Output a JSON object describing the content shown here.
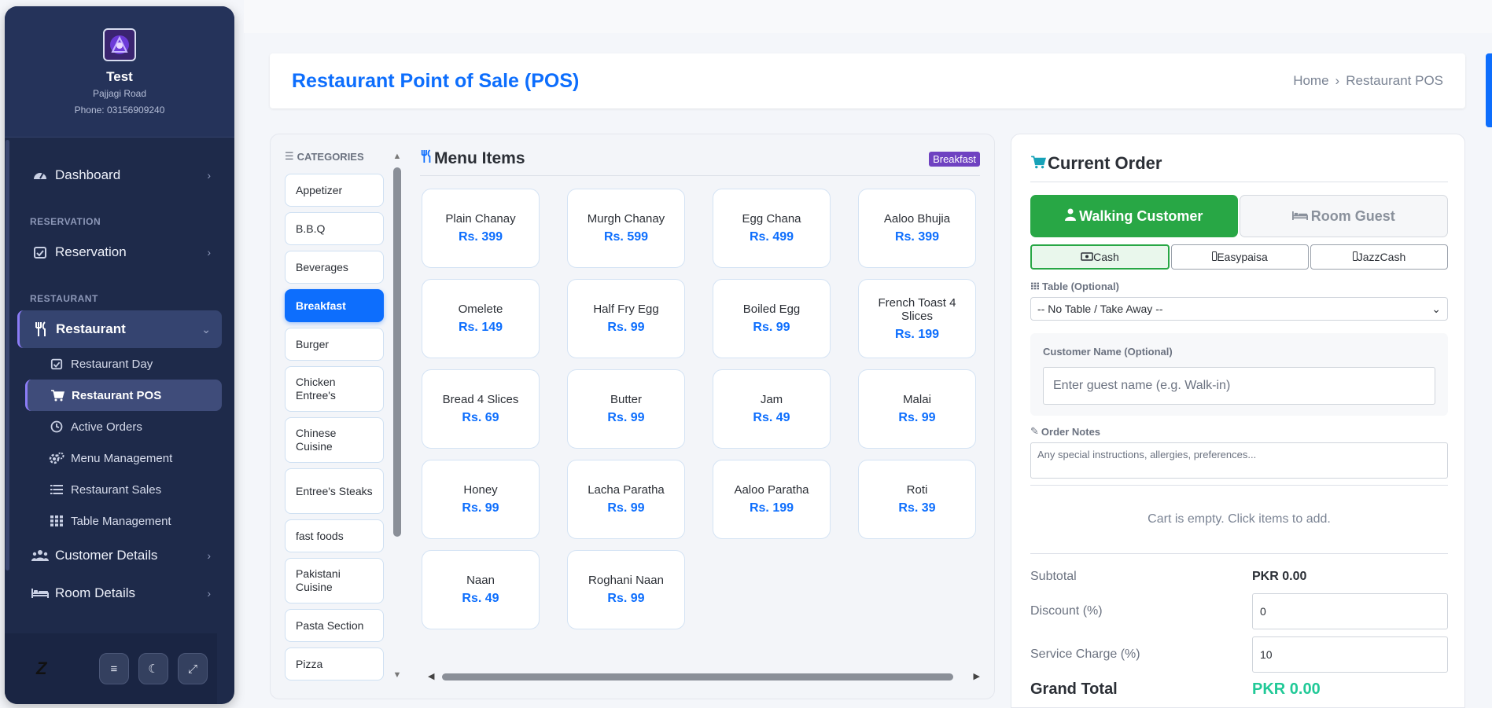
{
  "sidebar": {
    "business_name": "Test",
    "address": "Pajjagi Road",
    "phone": "Phone: 03156909240",
    "nav": {
      "dashboard": "Dashboard",
      "section_reservation": "RESERVATION",
      "reservation": "Reservation",
      "section_restaurant": "RESTAURANT",
      "restaurant": "Restaurant",
      "sub_items": [
        "Restaurant Day",
        "Restaurant POS",
        "Active Orders",
        "Menu Management",
        "Restaurant Sales",
        "Table Management"
      ],
      "customer_details": "Customer Details",
      "room_details": "Room Details"
    },
    "footer_logo": "Z"
  },
  "header": {
    "title": "Restaurant Point of Sale (POS)",
    "breadcrumb_home": "Home",
    "breadcrumb_current": "Restaurant POS"
  },
  "categories": {
    "heading": "CATEGORIES",
    "items": [
      "Appetizer",
      "B.B.Q",
      "Beverages",
      "Breakfast",
      "Burger",
      "Chicken Entree's",
      "Chinese Cuisine",
      "Entree's Steaks",
      "fast foods",
      "Pakistani Cuisine",
      "Pasta Section",
      "Pizza"
    ],
    "selected": "Breakfast"
  },
  "menu": {
    "title": "Menu Items",
    "badge": "Breakfast",
    "items": [
      {
        "name": "Plain Chanay",
        "price": "Rs. 399"
      },
      {
        "name": "Murgh Chanay",
        "price": "Rs. 599"
      },
      {
        "name": "Egg Chana",
        "price": "Rs. 499"
      },
      {
        "name": "Aaloo Bhujia",
        "price": "Rs. 399"
      },
      {
        "name": "Omelete",
        "price": "Rs. 149"
      },
      {
        "name": "Half Fry Egg",
        "price": "Rs. 99"
      },
      {
        "name": "Boiled Egg",
        "price": "Rs. 99"
      },
      {
        "name": "French Toast 4 Slices",
        "price": "Rs. 199"
      },
      {
        "name": "Bread 4 Slices",
        "price": "Rs. 69"
      },
      {
        "name": "Butter",
        "price": "Rs. 99"
      },
      {
        "name": "Jam",
        "price": "Rs. 49"
      },
      {
        "name": "Malai",
        "price": "Rs. 99"
      },
      {
        "name": "Honey",
        "price": "Rs. 99"
      },
      {
        "name": "Lacha Paratha",
        "price": "Rs. 99"
      },
      {
        "name": "Aaloo Paratha",
        "price": "Rs. 199"
      },
      {
        "name": "Roti",
        "price": "Rs. 39"
      },
      {
        "name": "Naan",
        "price": "Rs. 49"
      },
      {
        "name": "Roghani Naan",
        "price": "Rs. 99"
      }
    ]
  },
  "order": {
    "title": "Current Order",
    "walking_customer": "Walking Customer",
    "room_guest": "Room Guest",
    "payment": {
      "cash": "Cash",
      "easypaisa": "Easypaisa",
      "jazzcash": "JazzCash"
    },
    "table_label": "Table (Optional)",
    "table_value": "-- No Table / Take Away --",
    "customer_label": "Customer Name (Optional)",
    "customer_placeholder": "Enter guest name (e.g. Walk-in)",
    "notes_label": "Order Notes",
    "notes_placeholder": "Any special instructions, allergies, preferences...",
    "empty": "Cart is empty. Click items to add.",
    "subtotal_label": "Subtotal",
    "subtotal_value": "PKR 0.00",
    "discount_label": "Discount (%)",
    "discount_value": "0",
    "service_label": "Service Charge (%)",
    "service_value": "10",
    "grand_label": "Grand Total",
    "grand_value": "PKR 0.00"
  },
  "colors": {
    "sidebar_bg": "#1e2a4a",
    "primary": "#0d6efd",
    "success": "#28a745",
    "badge": "#6f42c1",
    "grand_total": "#20c997"
  }
}
